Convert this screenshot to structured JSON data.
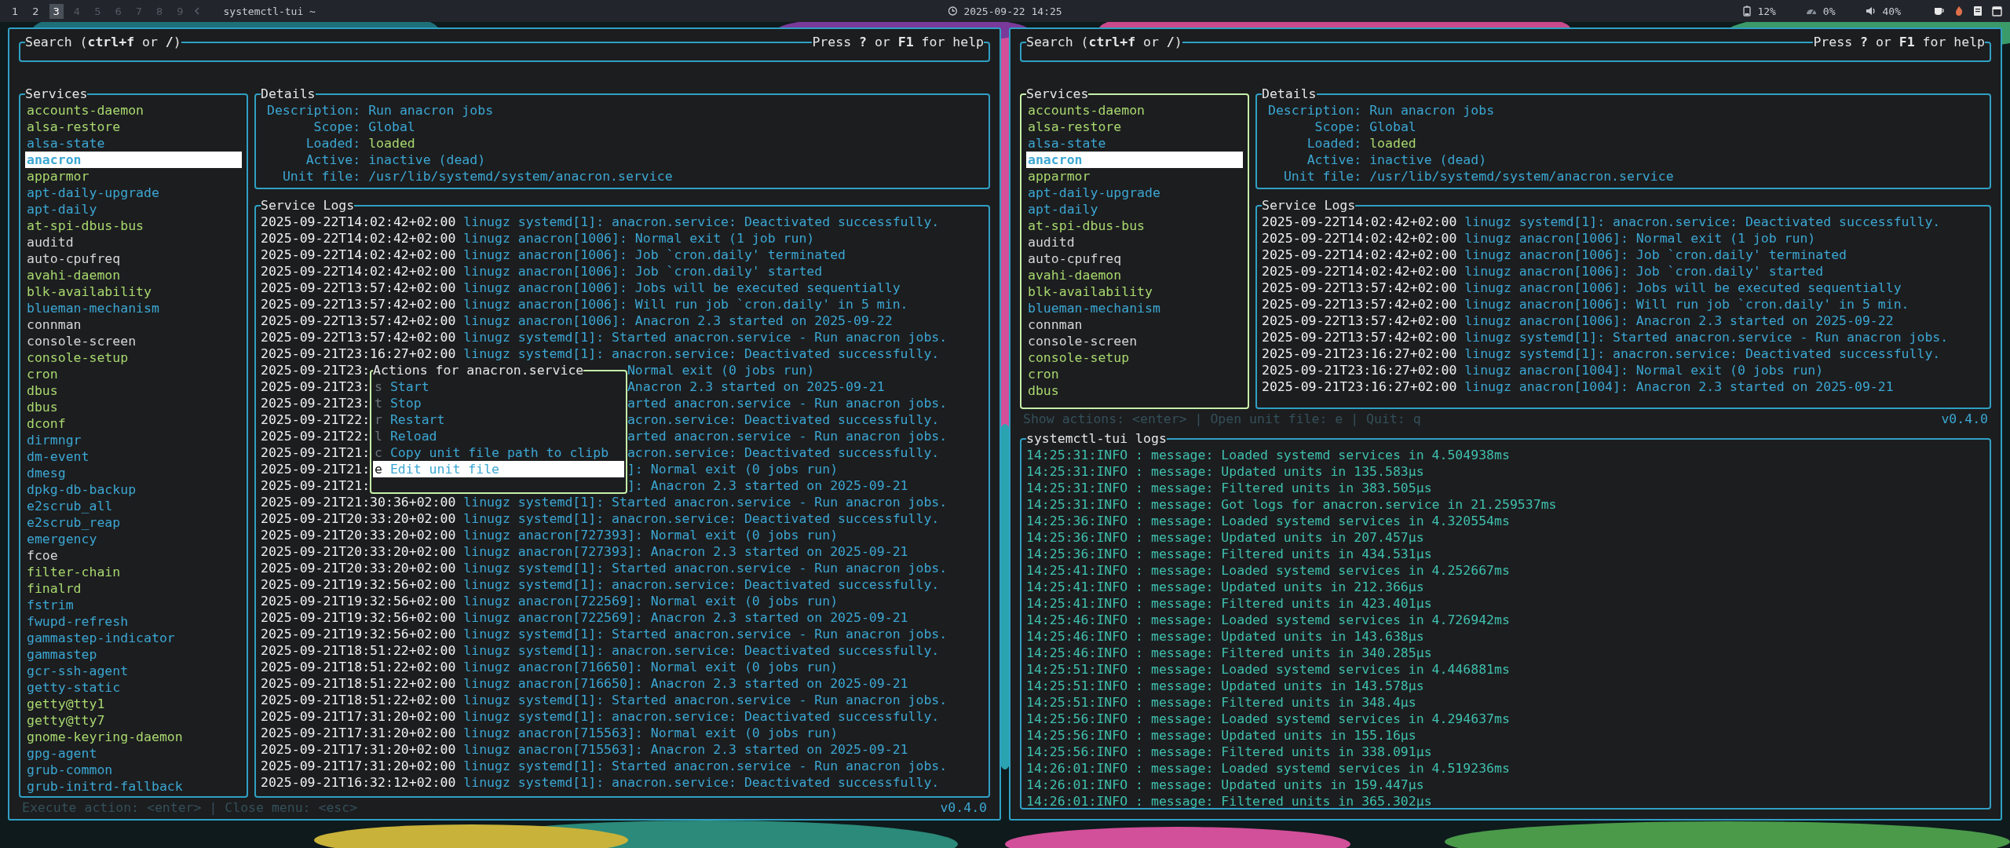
{
  "topbar": {
    "workspaces": [
      {
        "label": "1",
        "selected": false,
        "occupied": true
      },
      {
        "label": "2",
        "selected": false,
        "occupied": true
      },
      {
        "label": "3",
        "selected": true,
        "occupied": true
      },
      {
        "label": "4",
        "selected": false,
        "occupied": false
      },
      {
        "label": "5",
        "selected": false,
        "occupied": false
      },
      {
        "label": "6",
        "selected": false,
        "occupied": false
      },
      {
        "label": "7",
        "selected": false,
        "occupied": false
      },
      {
        "label": "8",
        "selected": false,
        "occupied": false
      },
      {
        "label": "9",
        "selected": false,
        "occupied": false
      }
    ],
    "window_title": "systemctl-tui ~",
    "clock": "2025-09-22 14:25",
    "readings": [
      "12%",
      "0%",
      "40%"
    ]
  },
  "panes": [
    {
      "search": {
        "label": "Search (**ctrl+f** or **/**)",
        "help": "Press **?** or **F1** for help"
      },
      "services": {
        "title": "Services",
        "focused": false,
        "items": [
          {
            "name": "accounts-daemon",
            "color": "#a8d86e",
            "selected": false
          },
          {
            "name": "alsa-restore",
            "color": "#a8d86e",
            "selected": false
          },
          {
            "name": "alsa-state",
            "color": "#3ba7d3",
            "selected": false
          },
          {
            "name": "anacron",
            "color": "#3ba7d3",
            "selected": true
          },
          {
            "name": "apparmor",
            "color": "#a8d86e",
            "selected": false
          },
          {
            "name": "apt-daily-upgrade",
            "color": "#3ba7d3",
            "selected": false
          },
          {
            "name": "apt-daily",
            "color": "#3ba7d3",
            "selected": false
          },
          {
            "name": "at-spi-dbus-bus",
            "color": "#a8d86e",
            "selected": false
          },
          {
            "name": "auditd",
            "color": "#d6d6d6",
            "selected": false
          },
          {
            "name": "auto-cpufreq",
            "color": "#d6d6d6",
            "selected": false
          },
          {
            "name": "avahi-daemon",
            "color": "#a8d86e",
            "selected": false
          },
          {
            "name": "blk-availability",
            "color": "#a8d86e",
            "selected": false
          },
          {
            "name": "blueman-mechanism",
            "color": "#3ba7d3",
            "selected": false
          },
          {
            "name": "connman",
            "color": "#d6d6d6",
            "selected": false
          },
          {
            "name": "console-screen",
            "color": "#d6d6d6",
            "selected": false
          },
          {
            "name": "console-setup",
            "color": "#a8d86e",
            "selected": false
          },
          {
            "name": "cron",
            "color": "#a8d86e",
            "selected": false
          },
          {
            "name": "dbus",
            "color": "#a8d86e",
            "selected": false
          },
          {
            "name": "dbus",
            "color": "#a8d86e",
            "selected": false
          },
          {
            "name": "dconf",
            "color": "#a8d86e",
            "selected": false
          },
          {
            "name": "dirmngr",
            "color": "#3ba7d3",
            "selected": false
          },
          {
            "name": "dm-event",
            "color": "#3ba7d3",
            "selected": false
          },
          {
            "name": "dmesg",
            "color": "#3ba7d3",
            "selected": false
          },
          {
            "name": "dpkg-db-backup",
            "color": "#3ba7d3",
            "selected": false
          },
          {
            "name": "e2scrub_all",
            "color": "#3ba7d3",
            "selected": false
          },
          {
            "name": "e2scrub_reap",
            "color": "#3ba7d3",
            "selected": false
          },
          {
            "name": "emergency",
            "color": "#3ba7d3",
            "selected": false
          },
          {
            "name": "fcoe",
            "color": "#d6d6d6",
            "selected": false
          },
          {
            "name": "filter-chain",
            "color": "#a8d86e",
            "selected": false
          },
          {
            "name": "finalrd",
            "color": "#a8d86e",
            "selected": false
          },
          {
            "name": "fstrim",
            "color": "#3ba7d3",
            "selected": false
          },
          {
            "name": "fwupd-refresh",
            "color": "#3ba7d3",
            "selected": false
          },
          {
            "name": "gammastep-indicator",
            "color": "#3ba7d3",
            "selected": false
          },
          {
            "name": "gammastep",
            "color": "#3ba7d3",
            "selected": false
          },
          {
            "name": "gcr-ssh-agent",
            "color": "#3ba7d3",
            "selected": false
          },
          {
            "name": "getty-static",
            "color": "#3ba7d3",
            "selected": false
          },
          {
            "name": "getty@tty1",
            "color": "#a8d86e",
            "selected": false
          },
          {
            "name": "getty@tty7",
            "color": "#a8d86e",
            "selected": false
          },
          {
            "name": "gnome-keyring-daemon",
            "color": "#a8d86e",
            "selected": false
          },
          {
            "name": "gpg-agent",
            "color": "#3ba7d3",
            "selected": false
          },
          {
            "name": "grub-common",
            "color": "#3ba7d3",
            "selected": false
          },
          {
            "name": "grub-initrd-fallback",
            "color": "#3ba7d3",
            "selected": false
          }
        ]
      },
      "details": {
        "title": "Details",
        "rows": [
          {
            "label": "Description:",
            "value": "Run anacron jobs",
            "color": "#3ba7d3"
          },
          {
            "label": "Scope:",
            "value": "Global",
            "color": "#3ba7d3"
          },
          {
            "label": "Loaded:",
            "value": "loaded",
            "color": "#a8d86e"
          },
          {
            "label": "Active:",
            "value": "inactive (dead)",
            "color": "#3ba7d3"
          },
          {
            "label": "Unit file:",
            "value": "/usr/lib/systemd/system/anacron.service",
            "color": "#3ba7d3"
          }
        ]
      },
      "logs": {
        "title": "Service Logs",
        "lines": [
          {
            "kind": "full",
            "time": "2025-09-22T14:02:42+02:00",
            "text": "linugz systemd[1]: anacron.service: Deactivated successfully."
          },
          {
            "kind": "full",
            "time": "2025-09-22T14:02:42+02:00",
            "text": "linugz anacron[1006]: Normal exit (1 job run)"
          },
          {
            "kind": "full",
            "time": "2025-09-22T14:02:42+02:00",
            "text": "linugz anacron[1006]: Job `cron.daily' terminated"
          },
          {
            "kind": "full",
            "time": "2025-09-22T14:02:42+02:00",
            "text": "linugz anacron[1006]: Job `cron.daily' started"
          },
          {
            "kind": "full",
            "time": "2025-09-22T13:57:42+02:00",
            "text": "linugz anacron[1006]: Jobs will be executed sequentially"
          },
          {
            "kind": "full",
            "time": "2025-09-22T13:57:42+02:00",
            "text": "linugz anacron[1006]: Will run job `cron.daily' in 5 min."
          },
          {
            "kind": "full",
            "time": "2025-09-22T13:57:42+02:00",
            "text": "linugz anacron[1006]: Anacron 2.3 started on 2025-09-22"
          },
          {
            "kind": "full",
            "time": "2025-09-22T13:57:42+02:00",
            "text": "linugz systemd[1]: Started anacron.service - Run anacron jobs."
          },
          {
            "kind": "full",
            "time": "2025-09-21T23:16:27+02:00",
            "text": "linugz systemd[1]: anacron.service: Deactivated successfully."
          },
          {
            "kind": "covered",
            "time": "2025-09-21T23:",
            "text": "Normal exit (0 jobs run)"
          },
          {
            "kind": "covered",
            "time": "2025-09-21T23:",
            "text": "Anacron 2.3 started on 2025-09-21"
          },
          {
            "kind": "covered",
            "time": "2025-09-21T23:",
            "text": "arted anacron.service - Run anacron jobs."
          },
          {
            "kind": "covered",
            "time": "2025-09-21T22:",
            "text": "acron.service: Deactivated successfully."
          },
          {
            "kind": "covered",
            "time": "2025-09-21T22:",
            "text": "arted anacron.service - Run anacron jobs."
          },
          {
            "kind": "covered",
            "time": "2025-09-21T21:",
            "text": "acron.service: Deactivated successfully."
          },
          {
            "kind": "covered",
            "time": "2025-09-21T21:",
            "text": "]: Normal exit (0 jobs run)"
          },
          {
            "kind": "covered",
            "time": "2025-09-21T21:",
            "text": "]: Anacron 2.3 started on 2025-09-21"
          },
          {
            "kind": "full",
            "time": "2025-09-21T21:30:36+02:00",
            "text": "linugz systemd[1]: Started anacron.service - Run anacron jobs."
          },
          {
            "kind": "full",
            "time": "2025-09-21T20:33:20+02:00",
            "text": "linugz systemd[1]: anacron.service: Deactivated successfully."
          },
          {
            "kind": "full",
            "time": "2025-09-21T20:33:20+02:00",
            "text": "linugz anacron[727393]: Normal exit (0 jobs run)"
          },
          {
            "kind": "full",
            "time": "2025-09-21T20:33:20+02:00",
            "text": "linugz anacron[727393]: Anacron 2.3 started on 2025-09-21"
          },
          {
            "kind": "full",
            "time": "2025-09-21T20:33:20+02:00",
            "text": "linugz systemd[1]: Started anacron.service - Run anacron jobs."
          },
          {
            "kind": "full",
            "time": "2025-09-21T19:32:56+02:00",
            "text": "linugz systemd[1]: anacron.service: Deactivated successfully."
          },
          {
            "kind": "full",
            "time": "2025-09-21T19:32:56+02:00",
            "text": "linugz anacron[722569]: Normal exit (0 jobs run)"
          },
          {
            "kind": "full",
            "time": "2025-09-21T19:32:56+02:00",
            "text": "linugz anacron[722569]: Anacron 2.3 started on 2025-09-21"
          },
          {
            "kind": "full",
            "time": "2025-09-21T19:32:56+02:00",
            "text": "linugz systemd[1]: Started anacron.service - Run anacron jobs."
          },
          {
            "kind": "full",
            "time": "2025-09-21T18:51:22+02:00",
            "text": "linugz systemd[1]: anacron.service: Deactivated successfully."
          },
          {
            "kind": "full",
            "time": "2025-09-21T18:51:22+02:00",
            "text": "linugz anacron[716650]: Normal exit (0 jobs run)"
          },
          {
            "kind": "full",
            "time": "2025-09-21T18:51:22+02:00",
            "text": "linugz anacron[716650]: Anacron 2.3 started on 2025-09-21"
          },
          {
            "kind": "full",
            "time": "2025-09-21T18:51:22+02:00",
            "text": "linugz systemd[1]: Started anacron.service - Run anacron jobs."
          },
          {
            "kind": "full",
            "time": "2025-09-21T17:31:20+02:00",
            "text": "linugz systemd[1]: anacron.service: Deactivated successfully."
          },
          {
            "kind": "full",
            "time": "2025-09-21T17:31:20+02:00",
            "text": "linugz anacron[715563]: Normal exit (0 jobs run)"
          },
          {
            "kind": "full",
            "time": "2025-09-21T17:31:20+02:00",
            "text": "linugz anacron[715563]: Anacron 2.3 started on 2025-09-21"
          },
          {
            "kind": "full",
            "time": "2025-09-21T17:31:20+02:00",
            "text": "linugz systemd[1]: Started anacron.service - Run anacron jobs."
          },
          {
            "kind": "full",
            "time": "2025-09-21T16:32:12+02:00",
            "text": "linugz systemd[1]: anacron.service: Deactivated successfully."
          }
        ]
      },
      "popup": {
        "title": "Actions for anacron.service",
        "items": [
          {
            "key": "s",
            "label": "Start",
            "selected": false
          },
          {
            "key": "t",
            "label": "Stop",
            "selected": false
          },
          {
            "key": "r",
            "label": "Restart",
            "selected": false
          },
          {
            "key": "l",
            "label": "Reload",
            "selected": false
          },
          {
            "key": "c",
            "label": "Copy unit file path to clipb",
            "selected": false
          },
          {
            "key": "e",
            "label": "Edit unit file",
            "selected": true
          }
        ]
      },
      "footer": {
        "hint": "Execute action: <enter> | Close menu: <esc>",
        "version": "v0.4.0"
      }
    },
    {
      "search": {
        "label": "Search (**ctrl+f** or **/**)",
        "help": "Press **?** or **F1** for help"
      },
      "services": {
        "title": "Services",
        "focused": true,
        "items": [
          {
            "name": "accounts-daemon",
            "color": "#a8d86e",
            "selected": false
          },
          {
            "name": "alsa-restore",
            "color": "#a8d86e",
            "selected": false
          },
          {
            "name": "alsa-state",
            "color": "#3ba7d3",
            "selected": false
          },
          {
            "name": "anacron",
            "color": "#3ba7d3",
            "selected": true
          },
          {
            "name": "apparmor",
            "color": "#a8d86e",
            "selected": false
          },
          {
            "name": "apt-daily-upgrade",
            "color": "#3ba7d3",
            "selected": false
          },
          {
            "name": "apt-daily",
            "color": "#3ba7d3",
            "selected": false
          },
          {
            "name": "at-spi-dbus-bus",
            "color": "#a8d86e",
            "selected": false
          },
          {
            "name": "auditd",
            "color": "#d6d6d6",
            "selected": false
          },
          {
            "name": "auto-cpufreq",
            "color": "#d6d6d6",
            "selected": false
          },
          {
            "name": "avahi-daemon",
            "color": "#a8d86e",
            "selected": false
          },
          {
            "name": "blk-availability",
            "color": "#a8d86e",
            "selected": false
          },
          {
            "name": "blueman-mechanism",
            "color": "#3ba7d3",
            "selected": false
          },
          {
            "name": "connman",
            "color": "#d6d6d6",
            "selected": false
          },
          {
            "name": "console-screen",
            "color": "#d6d6d6",
            "selected": false
          },
          {
            "name": "console-setup",
            "color": "#a8d86e",
            "selected": false
          },
          {
            "name": "cron",
            "color": "#a8d86e",
            "selected": false
          },
          {
            "name": "dbus",
            "color": "#a8d86e",
            "selected": false
          }
        ]
      },
      "details": {
        "title": "Details",
        "rows": [
          {
            "label": "Description:",
            "value": "Run anacron jobs",
            "color": "#3ba7d3"
          },
          {
            "label": "Scope:",
            "value": "Global",
            "color": "#3ba7d3"
          },
          {
            "label": "Loaded:",
            "value": "loaded",
            "color": "#a8d86e"
          },
          {
            "label": "Active:",
            "value": "inactive (dead)",
            "color": "#3ba7d3"
          },
          {
            "label": "Unit file:",
            "value": "/usr/lib/systemd/system/anacron.service",
            "color": "#3ba7d3"
          }
        ]
      },
      "logs": {
        "title": "Service Logs",
        "lines": [
          {
            "kind": "full",
            "time": "2025-09-22T14:02:42+02:00",
            "text": "linugz systemd[1]: anacron.service: Deactivated successfully."
          },
          {
            "kind": "full",
            "time": "2025-09-22T14:02:42+02:00",
            "text": "linugz anacron[1006]: Normal exit (1 job run)"
          },
          {
            "kind": "full",
            "time": "2025-09-22T14:02:42+02:00",
            "text": "linugz anacron[1006]: Job `cron.daily' terminated"
          },
          {
            "kind": "full",
            "time": "2025-09-22T14:02:42+02:00",
            "text": "linugz anacron[1006]: Job `cron.daily' started"
          },
          {
            "kind": "full",
            "time": "2025-09-22T13:57:42+02:00",
            "text": "linugz anacron[1006]: Jobs will be executed sequentially"
          },
          {
            "kind": "full",
            "time": "2025-09-22T13:57:42+02:00",
            "text": "linugz anacron[1006]: Will run job `cron.daily' in 5 min."
          },
          {
            "kind": "full",
            "time": "2025-09-22T13:57:42+02:00",
            "text": "linugz anacron[1006]: Anacron 2.3 started on 2025-09-22"
          },
          {
            "kind": "full",
            "time": "2025-09-22T13:57:42+02:00",
            "text": "linugz systemd[1]: Started anacron.service - Run anacron jobs."
          },
          {
            "kind": "full",
            "time": "2025-09-21T23:16:27+02:00",
            "text": "linugz systemd[1]: anacron.service: Deactivated successfully."
          },
          {
            "kind": "full",
            "time": "2025-09-21T23:16:27+02:00",
            "text": "linugz anacron[1004]: Normal exit (0 jobs run)"
          },
          {
            "kind": "full",
            "time": "2025-09-21T23:16:27+02:00",
            "text": "linugz anacron[1004]: Anacron 2.3 started on 2025-09-21"
          }
        ]
      },
      "footer": {
        "hint": "Show actions: <enter> | Open unit file: e | Quit: q",
        "version": "v0.4.0"
      },
      "app_logs": {
        "title": "systemctl-tui logs",
        "lines": [
          "14:25:31:INFO : message: Loaded systemd services in 4.504938ms",
          "14:25:31:INFO : message: Updated units in 135.583µs",
          "14:25:31:INFO : message: Filtered units in 383.505µs",
          "14:25:31:INFO : message: Got logs for anacron.service in 21.259537ms",
          "14:25:36:INFO : message: Loaded systemd services in 4.320554ms",
          "14:25:36:INFO : message: Updated units in 207.457µs",
          "14:25:36:INFO : message: Filtered units in 434.531µs",
          "14:25:41:INFO : message: Loaded systemd services in 4.252667ms",
          "14:25:41:INFO : message: Updated units in 212.366µs",
          "14:25:41:INFO : message: Filtered units in 423.401µs",
          "14:25:46:INFO : message: Loaded systemd services in 4.726942ms",
          "14:25:46:INFO : message: Updated units in 143.638µs",
          "14:25:46:INFO : message: Filtered units in 340.285µs",
          "14:25:51:INFO : message: Loaded systemd services in 4.446881ms",
          "14:25:51:INFO : message: Updated units in 143.578µs",
          "14:25:51:INFO : message: Filtered units in 348.4µs",
          "14:25:56:INFO : message: Loaded systemd services in 4.294637ms",
          "14:25:56:INFO : message: Updated units in 155.16µs",
          "14:25:56:INFO : message: Filtered units in 338.091µs",
          "14:26:01:INFO : message: Loaded systemd services in 4.519236ms",
          "14:26:01:INFO : message: Updated units in 159.447µs",
          "14:26:01:INFO : message: Filtered units in 365.302µs"
        ]
      }
    }
  ]
}
